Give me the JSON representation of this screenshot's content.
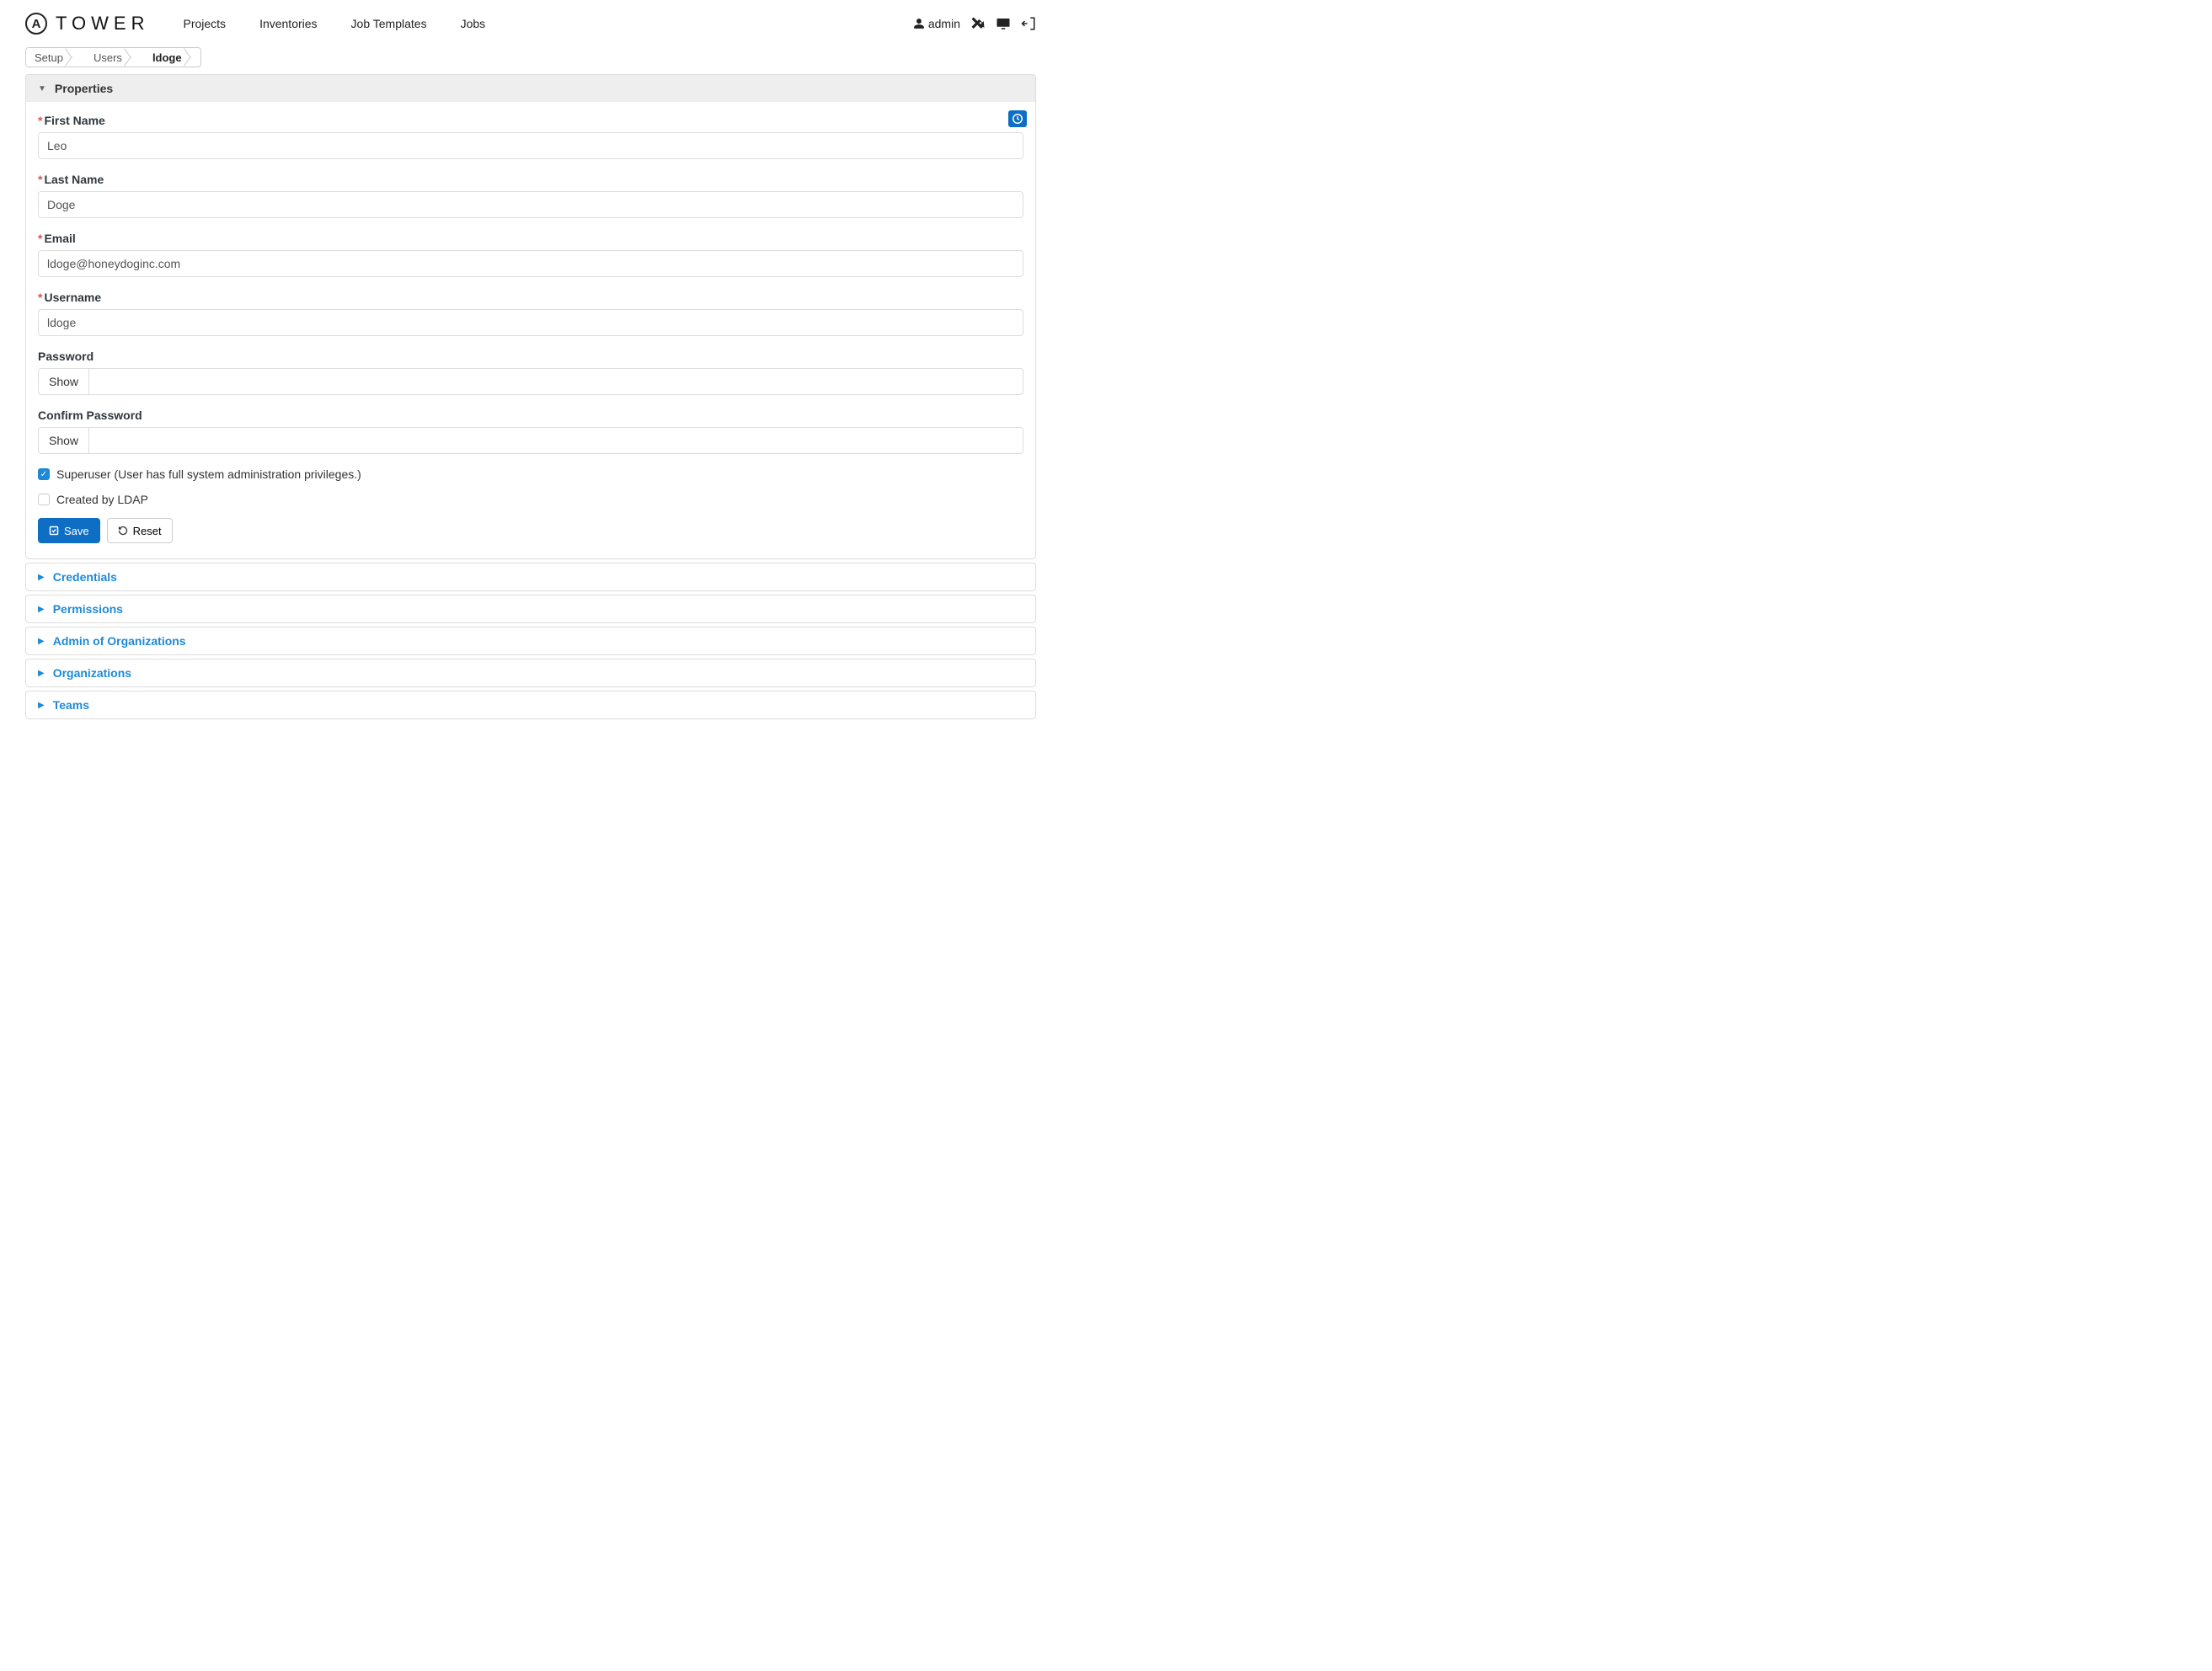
{
  "brand": {
    "logo_letter": "A",
    "name": "TOWER"
  },
  "nav": {
    "links": [
      "Projects",
      "Inventories",
      "Job Templates",
      "Jobs"
    ],
    "user": "admin"
  },
  "breadcrumb": {
    "items": [
      "Setup",
      "Users",
      "ldoge"
    ]
  },
  "panel_properties": {
    "title": "Properties"
  },
  "form": {
    "first_name": {
      "label": "First Name",
      "value": "Leo",
      "required": true
    },
    "last_name": {
      "label": "Last Name",
      "value": "Doge",
      "required": true
    },
    "email": {
      "label": "Email",
      "value": "ldoge@honeydoginc.com",
      "required": true
    },
    "username": {
      "label": "Username",
      "value": "ldoge",
      "required": true
    },
    "password": {
      "label": "Password",
      "show_button": "Show",
      "value": ""
    },
    "confirm_password": {
      "label": "Confirm Password",
      "show_button": "Show",
      "value": ""
    },
    "superuser": {
      "label": "Superuser (User has full system administration privileges.)",
      "checked": true
    },
    "ldap": {
      "label": "Created by LDAP",
      "checked": false
    },
    "save_label": "Save",
    "reset_label": "Reset"
  },
  "sub_panels": [
    {
      "label": "Credentials"
    },
    {
      "label": "Permissions"
    },
    {
      "label": "Admin of Organizations"
    },
    {
      "label": "Organizations"
    },
    {
      "label": "Teams"
    }
  ]
}
